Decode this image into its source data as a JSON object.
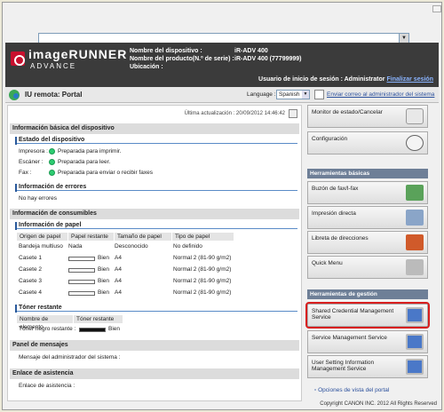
{
  "header": {
    "logo_line1": "imageRUNNER",
    "logo_line2": "ADVANCE",
    "device_name_label": "Nombre del dispositivo :",
    "device_name_value": "iR-ADV 400",
    "product_name_label": "Nombre del producto(N.º de serie) :",
    "product_name_value": "iR-ADV 400 (77799999)",
    "location_label": "Ubicación :",
    "user_login": "Usuario de inicio de sesión : Administrator",
    "logout_link": "Finalizar sesión"
  },
  "portalbar": {
    "title": "IU remota: Portal",
    "language_label": "Language :",
    "language_value": "Spanish",
    "admin_mail_link": "Enviar correo al administrador del sistema"
  },
  "left": {
    "last_update": "Última actualización : 20/09/2012 14:46:42",
    "basic_info_title": "Información básica del dispositivo",
    "device_status_title": "Estado del dispositivo",
    "status_rows": [
      {
        "label": "Impresora :",
        "value": "Preparada para imprimir."
      },
      {
        "label": "Escáner :",
        "value": "Preparada para leer."
      },
      {
        "label": "Fax :",
        "value": "Preparada para enviar o recibir faxes"
      }
    ],
    "errors_title": "Información de errores",
    "errors_value": "No hay errores",
    "consumables_title": "Información de consumibles",
    "paper_title": "Información de papel",
    "paper_headers": [
      "Origen de papel",
      "Papel restante",
      "Tamaño de papel",
      "Tipo de papel"
    ],
    "paper_rows": [
      {
        "source": "Bandeja multiuso",
        "remaining": "Nada",
        "size": "Desconocido",
        "type": "No definido",
        "bar": false
      },
      {
        "source": "Casete 1",
        "remaining": "Bien",
        "size": "A4",
        "type": "Normal 2 (81-90 g/m2)",
        "bar": true
      },
      {
        "source": "Casete 2",
        "remaining": "Bien",
        "size": "A4",
        "type": "Normal 2 (81-90 g/m2)",
        "bar": true
      },
      {
        "source": "Casete 3",
        "remaining": "Bien",
        "size": "A4",
        "type": "Normal 2 (81-90 g/m2)",
        "bar": true
      },
      {
        "source": "Casete 4",
        "remaining": "Bien",
        "size": "A4",
        "type": "Normal 2 (81-90 g/m2)",
        "bar": true
      }
    ],
    "toner_title": "Tóner restante",
    "toner_headers": [
      "Nombre de elemento",
      "Tóner restante"
    ],
    "toner_row": {
      "name": "Tóner negro restante :",
      "value": "Bien"
    },
    "messages_title": "Panel de mensajes",
    "messages_value": "Mensaje del administrador del sistema :",
    "support_title": "Enlace de asistencia",
    "support_value": "Enlace de asistencia :"
  },
  "right": {
    "monitor_btn": "Monitor de estado/Cancelar",
    "config_btn": "Configuración",
    "basic_tools_title": "Herramientas básicas",
    "basic_tools": [
      "Buzón de fax/I-fax",
      "Impresión directa",
      "Libreta de direcciones",
      "Quick Menu"
    ],
    "mgmt_tools_title": "Herramientas de gestión",
    "mgmt_tools": [
      "Shared Credential Management Service",
      "Service Management Service",
      "User Setting Information Management Service"
    ],
    "portal_options": "Opciones de vista del portal"
  },
  "footer": {
    "copyright": "Copyright CANON INC. 2012 All Rights Reserved"
  },
  "colors": {
    "header_bg": "#3b3b3b",
    "highlight": "#d81e1e",
    "section_bar": "#6e7f97"
  }
}
